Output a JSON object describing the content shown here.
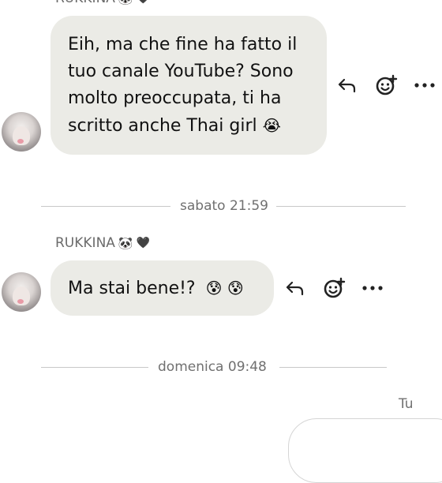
{
  "thread": {
    "top_sender": {
      "name": "RUKKINA",
      "emoji_1": "🐼",
      "emoji_2": "🖤"
    },
    "message_1": {
      "text": "Eih, ma che fine ha fatto il tuo canale YouTube? Sono molto preoccupata, ti ha scritto anche Thai girl",
      "emoji": "😭"
    },
    "divider_1": "sabato 21:59",
    "sender_2": {
      "name": "RUKKINA",
      "emoji_1": "🐼",
      "emoji_2": "🖤"
    },
    "message_2": {
      "text": "Ma stai bene!?",
      "emoji": "😰 😰"
    },
    "divider_2": "domenica 09:48",
    "own_label": "Tu"
  },
  "icons": {
    "reply": "reply-icon",
    "react": "add-reaction-icon",
    "more": "more-options-icon"
  }
}
